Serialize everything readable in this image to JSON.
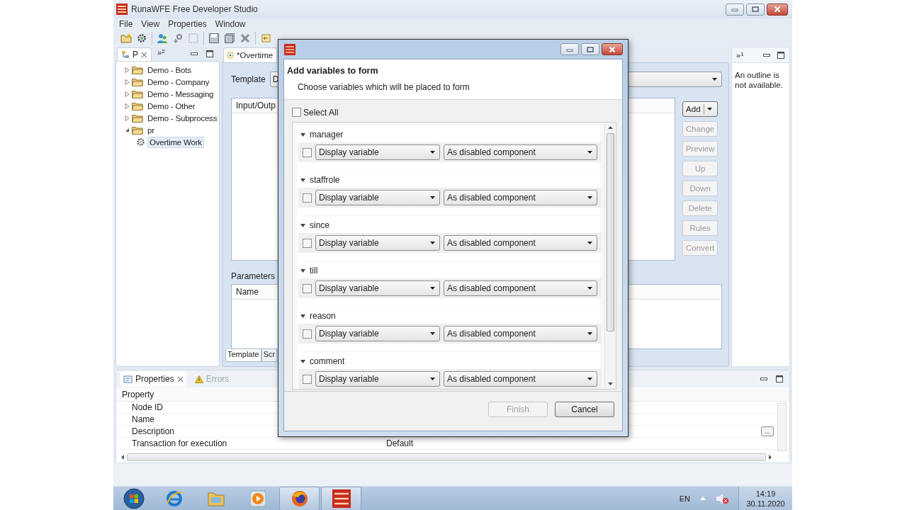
{
  "window": {
    "title": "RunaWFE Free Developer Studio"
  },
  "menu": [
    {
      "label": "File"
    },
    {
      "label": "View"
    },
    {
      "label": "Properties"
    },
    {
      "label": "Window"
    }
  ],
  "explorer": {
    "tab": "P",
    "overflow": "»",
    "overflow_count": "2",
    "tree": [
      {
        "label": "Demo - Bots",
        "kind": "folder",
        "expanded": false,
        "selected": false
      },
      {
        "label": "Demo - Company",
        "kind": "folder",
        "expanded": false,
        "selected": false
      },
      {
        "label": "Demo - Messaging",
        "kind": "folder",
        "expanded": false,
        "selected": false
      },
      {
        "label": "Demo - Other",
        "kind": "folder",
        "expanded": false,
        "selected": false
      },
      {
        "label": "Demo - Subprocess",
        "kind": "folder",
        "expanded": false,
        "selected": false
      },
      {
        "label": "pr",
        "kind": "folder",
        "expanded": true,
        "selected": false,
        "children": [
          {
            "label": "Overtime Work",
            "kind": "process",
            "selected": true
          }
        ]
      }
    ]
  },
  "editor": {
    "tab": "*Overtime",
    "template_label": "Template",
    "template_value": "D",
    "io_column": "Input/Outp",
    "buttons": [
      {
        "label": "Add",
        "kind": "split",
        "disabled": false
      },
      {
        "label": "Change",
        "kind": "plain",
        "disabled": true
      },
      {
        "label": "Preview",
        "kind": "plain",
        "disabled": true
      },
      {
        "label": "Up",
        "kind": "plain",
        "disabled": true
      },
      {
        "label": "Down",
        "kind": "plain",
        "disabled": true
      },
      {
        "label": "Delete",
        "kind": "plain",
        "disabled": true
      },
      {
        "label": "Rules",
        "kind": "plain",
        "disabled": true
      },
      {
        "label": "Convert",
        "kind": "plain",
        "disabled": true
      }
    ],
    "parameters_label": "Parameters",
    "parameters_column": "Name",
    "bottom_tabs": [
      {
        "label": "Template",
        "selected": true
      },
      {
        "label": "Scr",
        "selected": false
      }
    ]
  },
  "outline": {
    "overflow": "»",
    "overflow_count": "1",
    "message": "An outline is not available."
  },
  "properties": {
    "tabs": [
      {
        "label": "Properties",
        "kind": "properties",
        "selected": true
      },
      {
        "label": "Errors",
        "kind": "errors",
        "selected": false
      }
    ],
    "column": "Property",
    "rows": [
      {
        "property": "Node ID"
      },
      {
        "property": "Name"
      },
      {
        "property": "Description",
        "button": "..."
      },
      {
        "property": "Transaction for execution",
        "value": "Default"
      }
    ]
  },
  "dialog": {
    "heading": "Add variables to form",
    "description": "Choose variables which will be placed to form",
    "select_all": {
      "label": "Select All",
      "checked": false
    },
    "variables": [
      {
        "name": "manager",
        "expanded": true,
        "checked": false,
        "display": "Display variable",
        "mode": "As disabled component"
      },
      {
        "name": "staffrole",
        "expanded": true,
        "checked": false,
        "display": "Display variable",
        "mode": "As disabled component"
      },
      {
        "name": "since",
        "expanded": true,
        "checked": false,
        "display": "Display variable",
        "mode": "As disabled component"
      },
      {
        "name": "till",
        "expanded": true,
        "checked": false,
        "display": "Display variable",
        "mode": "As disabled component"
      },
      {
        "name": "reason",
        "expanded": true,
        "checked": false,
        "display": "Display variable",
        "mode": "As disabled component"
      },
      {
        "name": "comment",
        "expanded": true,
        "checked": false,
        "display": "Display variable",
        "mode": "As disabled component"
      }
    ],
    "buttons": [
      {
        "label": "Finish",
        "disabled": true
      },
      {
        "label": "Cancel",
        "disabled": false
      }
    ]
  },
  "taskbar": {
    "apps": [
      {
        "kind": "globe",
        "running": false
      },
      {
        "kind": "folder",
        "running": false
      },
      {
        "kind": "player",
        "running": false
      },
      {
        "kind": "browser",
        "running": true
      },
      {
        "kind": "studio",
        "running": true
      }
    ],
    "language": "EN",
    "time": "14:19",
    "date": "30.11.2020"
  }
}
